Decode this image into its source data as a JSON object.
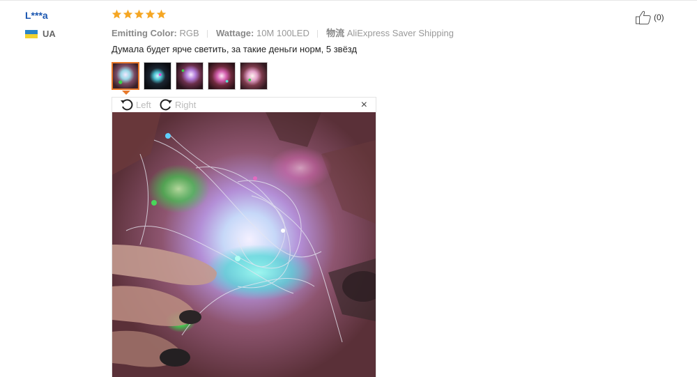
{
  "review": {
    "user": "L***a",
    "country_code": "UA",
    "rating": 5,
    "attributes": [
      {
        "key": "Emitting Color:",
        "value": "RGB"
      },
      {
        "key": "Wattage:",
        "value": "10M 100LED"
      },
      {
        "key": "物流",
        "value": "AliExpress Saver Shipping"
      }
    ],
    "text": "Думала будет ярче светить, за такие деньги норм, 5 звёзд",
    "thumbnail_count": 5,
    "active_thumbnail": 1
  },
  "viewer": {
    "rotate_left_label": "Left",
    "rotate_right_label": "Right",
    "close_symbol": "×"
  },
  "helpful": {
    "count": "(0)"
  },
  "colors": {
    "username": "#1a56b0",
    "star": "#f5a623",
    "active_border": "#e8792b"
  },
  "icons": [
    "ukraine-flag-icon",
    "star-icon",
    "rotate-left-icon",
    "rotate-right-icon",
    "close-icon",
    "thumbs-up-icon"
  ]
}
